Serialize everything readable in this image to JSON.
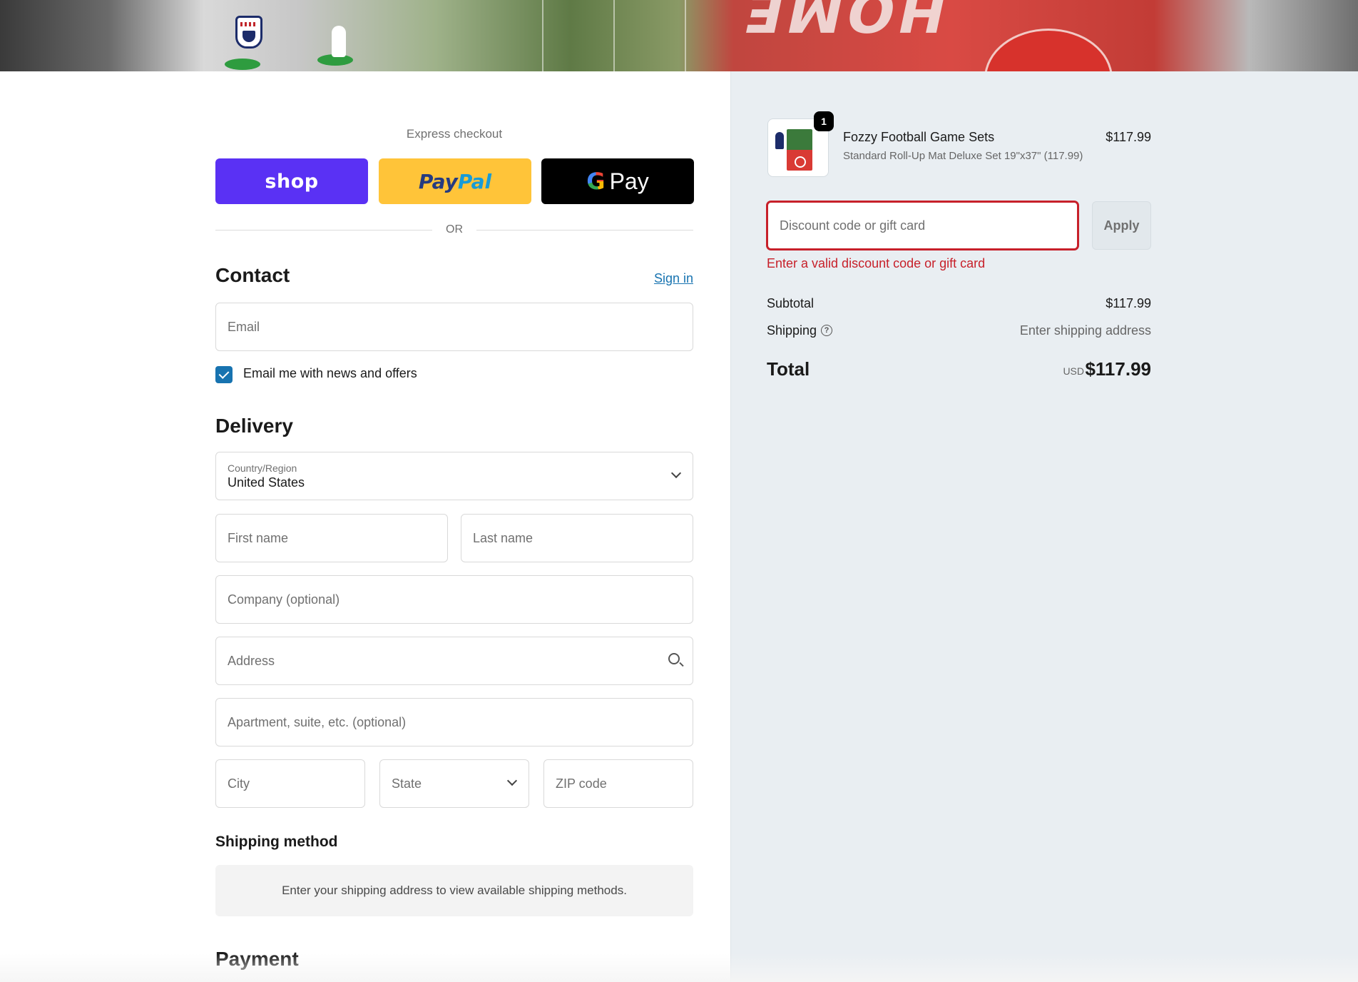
{
  "express": {
    "title": "Express checkout",
    "shop_label": "shop",
    "paypal_label_1": "Pay",
    "paypal_label_2": "Pal",
    "gpay_label": "Pay",
    "or_label": "OR"
  },
  "contact": {
    "heading": "Contact",
    "signin_label": "Sign in",
    "email_placeholder": "Email",
    "newsletter_label": "Email me with news and offers",
    "newsletter_checked": true
  },
  "delivery": {
    "heading": "Delivery",
    "country_label": "Country/Region",
    "country_value": "United States",
    "first_name": "First name",
    "last_name": "Last name",
    "company": "Company (optional)",
    "address": "Address",
    "apartment": "Apartment, suite, etc. (optional)",
    "city": "City",
    "state": "State",
    "zip": "ZIP code"
  },
  "shipping_method": {
    "heading": "Shipping method",
    "note": "Enter your shipping address to view available shipping methods."
  },
  "payment": {
    "heading": "Payment"
  },
  "cart": {
    "quantity": "1",
    "product_name": "Fozzy Football Game Sets",
    "product_variant": "Standard Roll-Up Mat Deluxe Set 19\"x37\" (117.99)",
    "product_price": "$117.99"
  },
  "discount": {
    "placeholder": "Discount code or gift card",
    "apply_label": "Apply",
    "error": "Enter a valid discount code or gift card"
  },
  "summary": {
    "subtotal_label": "Subtotal",
    "subtotal_value": "$117.99",
    "shipping_label": "Shipping",
    "shipping_value": "Enter shipping address",
    "total_label": "Total",
    "currency": "USD",
    "total_value": "$117.99"
  },
  "colors": {
    "accent": "#1773b0",
    "error": "#c7202a",
    "shop": "#5a31f4",
    "paypal": "#ffc439",
    "gpay": "#000000",
    "summary_bg": "#e9eef2"
  }
}
